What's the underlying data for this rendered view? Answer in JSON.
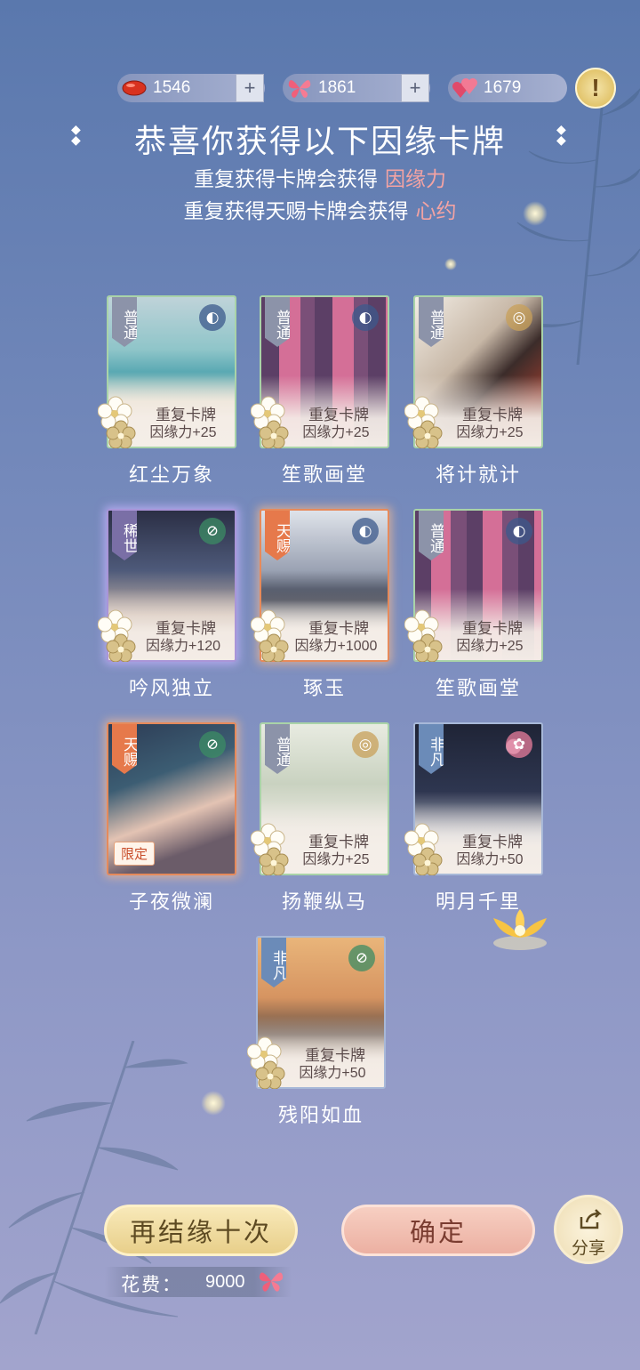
{
  "currencies": [
    {
      "name": "red-gem",
      "value": "1546",
      "has_plus": true,
      "color": "#d8321f"
    },
    {
      "name": "butterfly",
      "value": "1861",
      "has_plus": true,
      "color": "#ef5f7a"
    },
    {
      "name": "hearts",
      "value": "1679",
      "has_plus": false,
      "color": "#e04a6a"
    }
  ],
  "info_symbol": "!",
  "title": "恭喜你获得以下因缘卡牌",
  "subtitle1": {
    "text": "重复获得卡牌会获得",
    "highlight": "因缘力"
  },
  "subtitle2": {
    "text": "重复获得天赐卡牌会获得",
    "highlight": "心约"
  },
  "cards": [
    {
      "tag": "普通",
      "rarity": "common",
      "dup_label": "重复卡牌",
      "reward": "因缘力+25",
      "name": "红尘万象",
      "emblem": "fan-icon",
      "limited": ""
    },
    {
      "tag": "普通",
      "rarity": "common",
      "dup_label": "重复卡牌",
      "reward": "因缘力+25",
      "name": "笙歌画堂",
      "emblem": "fan-icon",
      "limited": ""
    },
    {
      "tag": "普通",
      "rarity": "common",
      "dup_label": "重复卡牌",
      "reward": "因缘力+25",
      "name": "将计就计",
      "emblem": "coin-icon",
      "limited": ""
    },
    {
      "tag": "稀世",
      "rarity": "rare",
      "dup_label": "重复卡牌",
      "reward": "因缘力+120",
      "name": "吟风独立",
      "emblem": "jade-icon",
      "limited": ""
    },
    {
      "tag": "天赐",
      "rarity": "sky",
      "dup_label": "重复卡牌",
      "reward": "因缘力+1000",
      "name": "琢玉",
      "emblem": "fan-icon",
      "limited": ""
    },
    {
      "tag": "普通",
      "rarity": "common",
      "dup_label": "重复卡牌",
      "reward": "因缘力+25",
      "name": "笙歌画堂",
      "emblem": "fan-icon",
      "limited": ""
    },
    {
      "tag": "天赐",
      "rarity": "sky",
      "dup_label": "",
      "reward": "",
      "name": "子夜微澜",
      "emblem": "jade-icon",
      "limited": "限定"
    },
    {
      "tag": "普通",
      "rarity": "common",
      "dup_label": "重复卡牌",
      "reward": "因缘力+25",
      "name": "扬鞭纵马",
      "emblem": "coin-icon",
      "limited": ""
    },
    {
      "tag": "非凡",
      "rarity": "fan",
      "dup_label": "重复卡牌",
      "reward": "因缘力+50",
      "name": "明月千里",
      "emblem": "plum-icon",
      "limited": ""
    },
    {
      "tag": "非凡",
      "rarity": "fan",
      "dup_label": "重复卡牌",
      "reward": "因缘力+50",
      "name": "残阳如血",
      "emblem": "jade-icon",
      "limited": ""
    }
  ],
  "buttons": {
    "again": "再结缘十次",
    "confirm": "确定",
    "share": "分享"
  },
  "cost": {
    "label": "花费：",
    "value": "9000"
  },
  "colors": {
    "highlight": "#f3a3a3",
    "gold": "#e8cf8a",
    "pink_button": "#ecb0a2"
  }
}
